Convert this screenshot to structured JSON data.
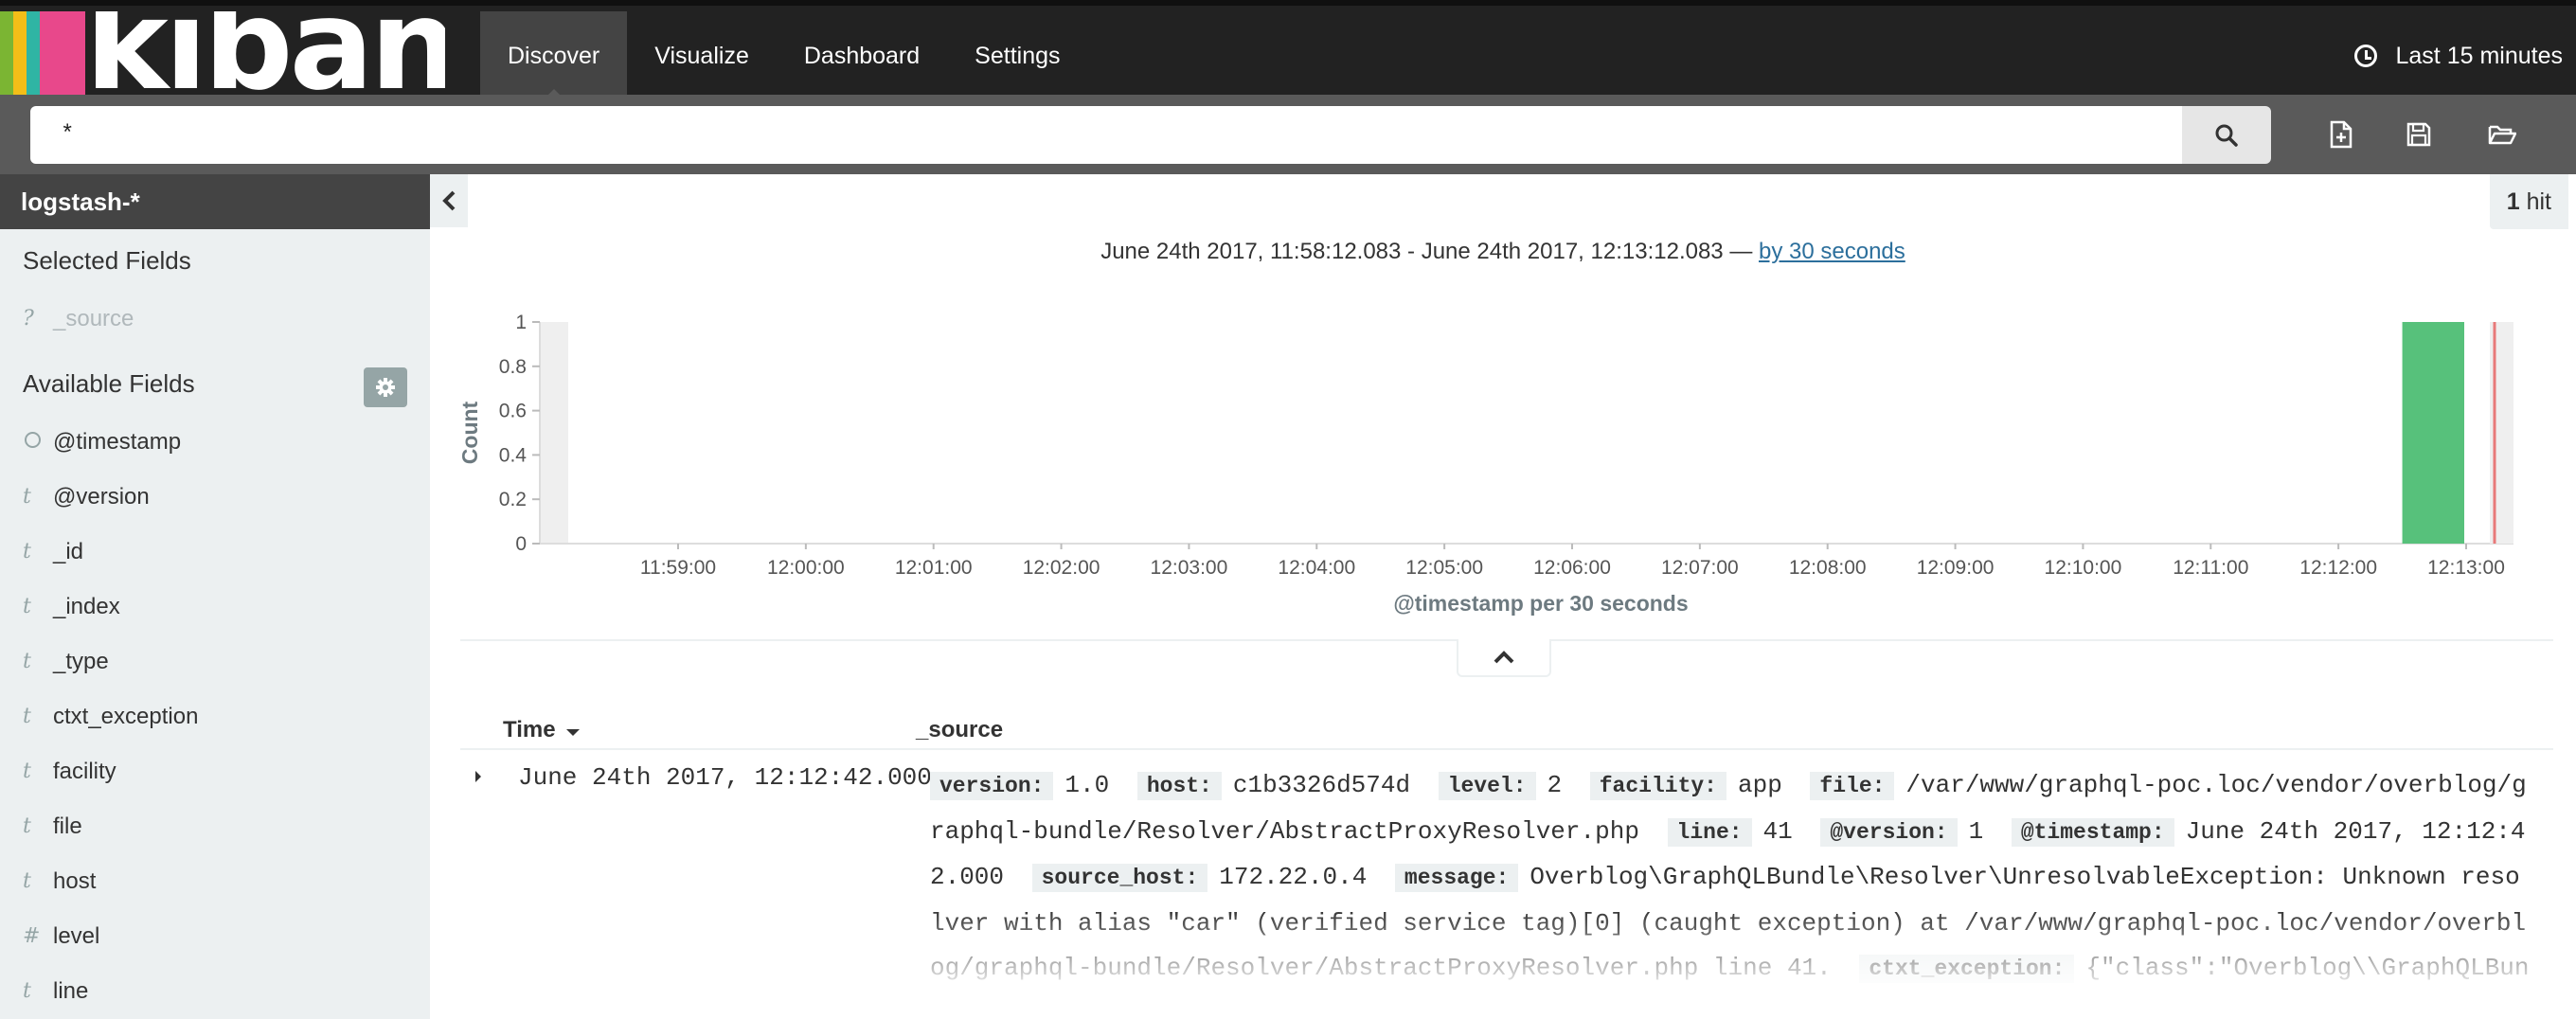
{
  "app": {
    "logo_text": "kibana"
  },
  "nav": {
    "tabs": [
      {
        "label": "Discover",
        "active": true
      },
      {
        "label": "Visualize",
        "active": false
      },
      {
        "label": "Dashboard",
        "active": false
      },
      {
        "label": "Settings",
        "active": false
      }
    ],
    "timepicker_label": "Last 15 minutes"
  },
  "search": {
    "value": "*"
  },
  "sidebar": {
    "index_pattern": "logstash-*",
    "selected_title": "Selected Fields",
    "selected_fields": [
      {
        "type": "?",
        "name": "_source"
      }
    ],
    "available_title": "Available Fields",
    "available_fields": [
      {
        "type": "clock",
        "name": "@timestamp"
      },
      {
        "type": "t",
        "name": "@version"
      },
      {
        "type": "t",
        "name": "_id"
      },
      {
        "type": "t",
        "name": "_index"
      },
      {
        "type": "t",
        "name": "_type"
      },
      {
        "type": "t",
        "name": "ctxt_exception"
      },
      {
        "type": "t",
        "name": "facility"
      },
      {
        "type": "t",
        "name": "file"
      },
      {
        "type": "t",
        "name": "host"
      },
      {
        "type": "#",
        "name": "level"
      },
      {
        "type": "t",
        "name": "line"
      }
    ]
  },
  "hits": {
    "count": "1",
    "label": "hit"
  },
  "histogram": {
    "range_text": "June 24th 2017, 11:58:12.083 - June 24th 2017, 12:13:12.083 —",
    "interval_link": "by 30 seconds"
  },
  "chart_data": {
    "type": "bar",
    "ylabel": "Count",
    "xlabel": "@timestamp per 30 seconds",
    "ylim": [
      0,
      1
    ],
    "y_ticks": [
      "0",
      "0.2",
      "0.4",
      "0.6",
      "0.8",
      "1"
    ],
    "x_ticks": [
      "11:59:00",
      "12:00:00",
      "12:01:00",
      "12:02:00",
      "12:03:00",
      "12:04:00",
      "12:05:00",
      "12:06:00",
      "12:07:00",
      "12:08:00",
      "12:09:00",
      "12:10:00",
      "12:11:00",
      "12:12:00",
      "12:13:00"
    ],
    "bars": [
      {
        "x": "12:12:30",
        "value": 1
      }
    ],
    "bar_color": "#57c17b",
    "now_marker_color": "#e87a7a",
    "grid": false
  },
  "table": {
    "time_header": "Time",
    "source_header": "_source",
    "rows": [
      {
        "time": "June 24th 2017, 12:12:42.000",
        "source": [
          {
            "k": "version:",
            "v": "1.0"
          },
          {
            "k": "host:",
            "v": "c1b3326d574d"
          },
          {
            "k": "level:",
            "v": "2"
          },
          {
            "k": "facility:",
            "v": "app"
          },
          {
            "k": "file:",
            "v": "/var/www/graphql-poc.loc/vendor/overblog/graphql-bundle/Resolver/AbstractProxyResolver.php"
          },
          {
            "k": "line:",
            "v": "41"
          },
          {
            "k": "@version:",
            "v": "1"
          },
          {
            "k": "@timestamp:",
            "v": "June 24th 2017, 12:12:42.000"
          },
          {
            "k": "source_host:",
            "v": "172.22.0.4"
          },
          {
            "k": "message:",
            "v": "Overblog\\GraphQLBundle\\Resolver\\UnresolvableException: Unknown resolver with alias \"car\" (verified service tag)[0] (caught exception) at /var/www/graphql-poc.loc/vendor/overblog/graphql-bundle/Resolver/AbstractProxyResolver.php line 41."
          },
          {
            "k": "ctxt_exception:",
            "v": "{\"class\":\"Overblog\\\\GraphQLBundle\\\\Resolver\\\\UnresolvableException"
          }
        ]
      }
    ]
  }
}
